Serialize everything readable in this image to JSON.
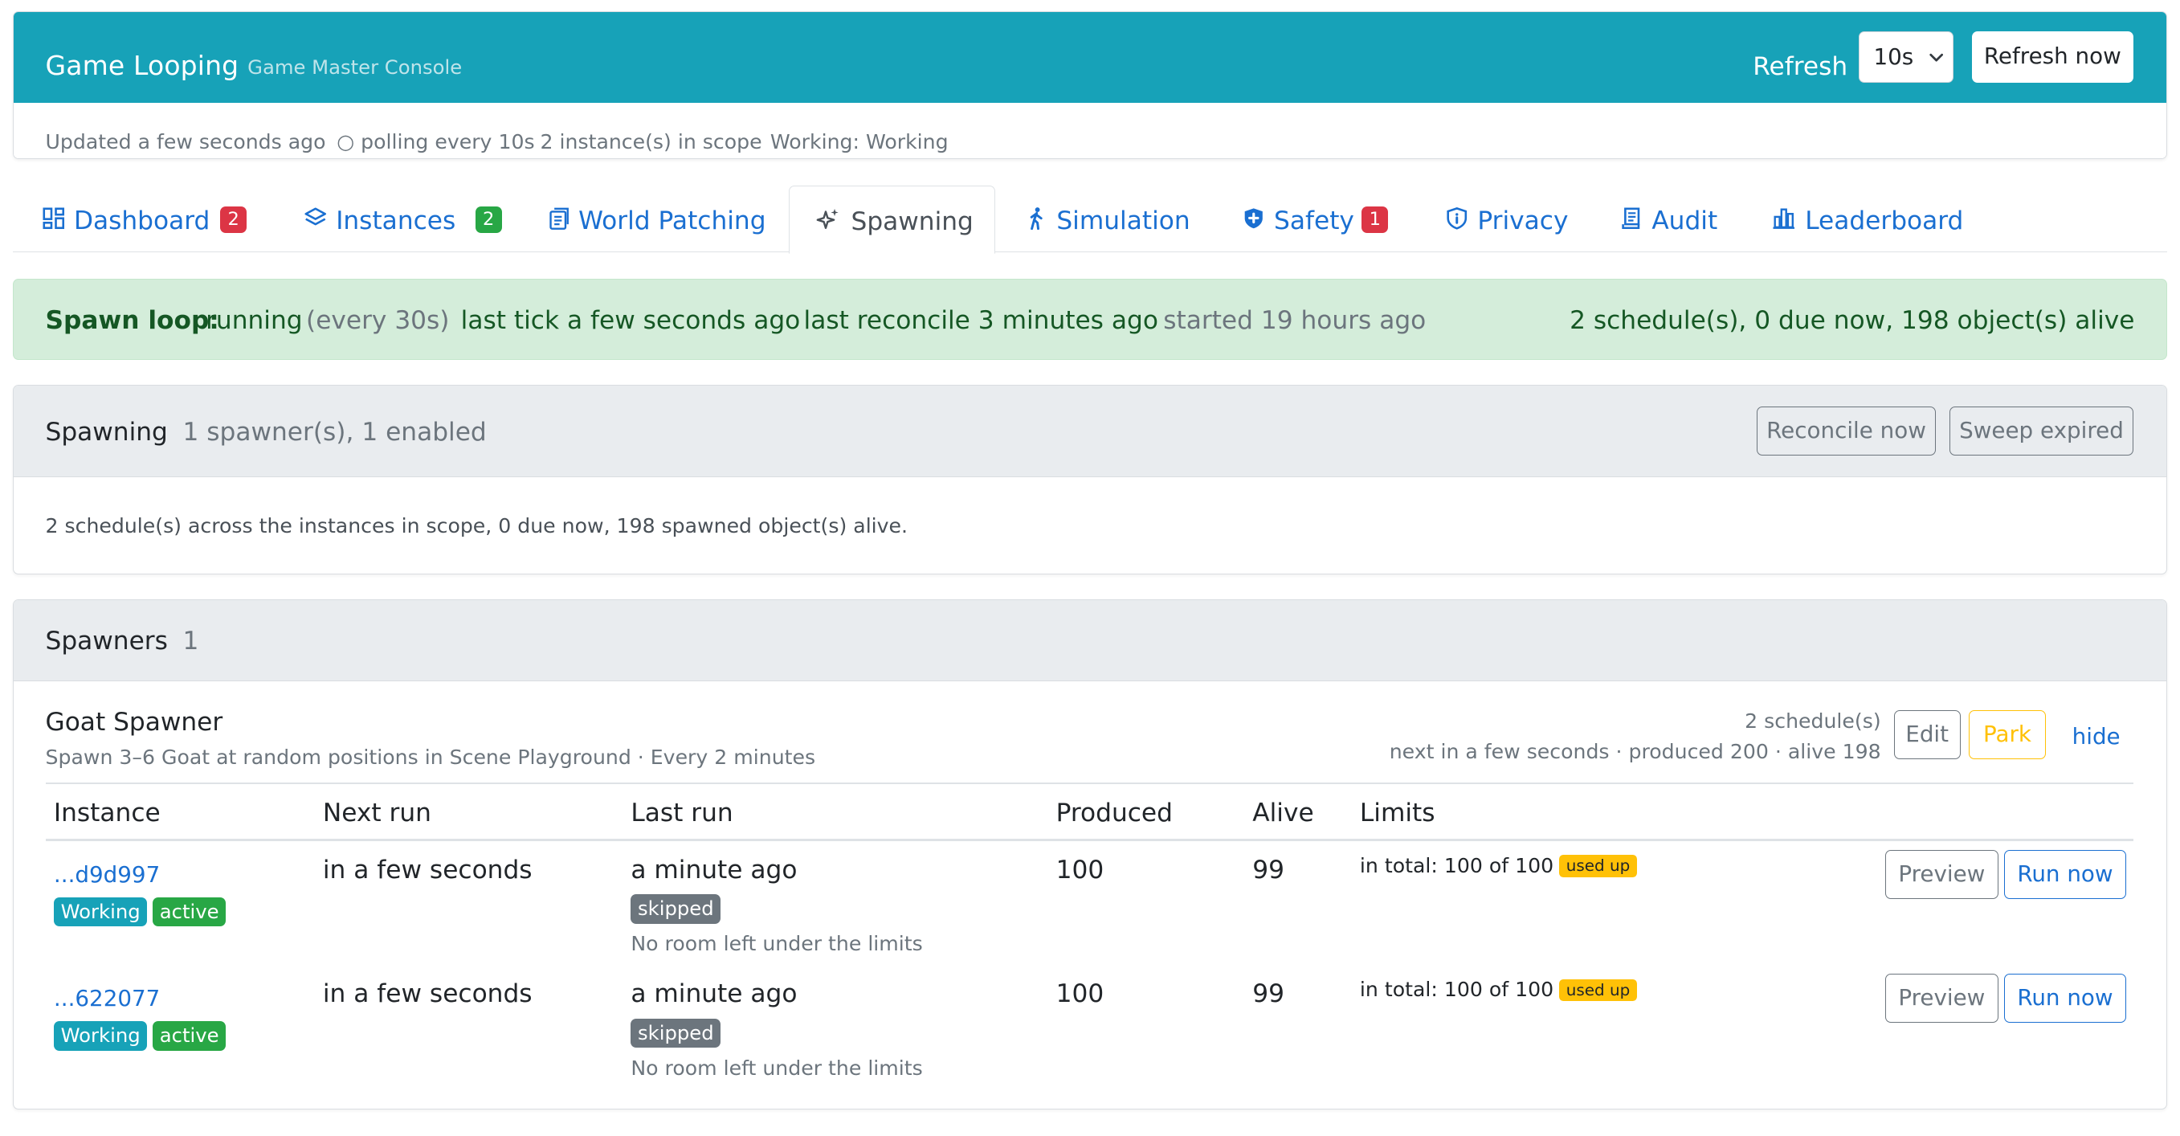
{
  "header": {
    "title": "Game Looping",
    "subtitle": "Game Master Console",
    "refresh_label": "Refresh",
    "refresh_interval": "10s",
    "refresh_now": "Refresh now"
  },
  "status": {
    "updated": "Updated a few seconds ago",
    "polling": "○ polling every 10s",
    "scope": "2 instance(s) in scope",
    "working": "Working: Working"
  },
  "tabs": [
    {
      "label": "Dashboard",
      "icon": "dashboard-icon",
      "count": "2",
      "count_color": "#dc3545"
    },
    {
      "label": "Instances",
      "icon": "layers-icon",
      "count": "2",
      "count_color": "#28a745"
    },
    {
      "label": "World Patching",
      "icon": "document-icon"
    },
    {
      "label": "Spawning",
      "icon": "sparkles-icon",
      "active": true
    },
    {
      "label": "Simulation",
      "icon": "walking-person-icon"
    },
    {
      "label": "Safety",
      "icon": "shield-plus-icon",
      "count": "1",
      "count_color": "#dc3545"
    },
    {
      "label": "Privacy",
      "icon": "shield-info-icon"
    },
    {
      "label": "Audit",
      "icon": "journal-icon"
    },
    {
      "label": "Leaderboard",
      "icon": "bar-chart-icon"
    }
  ],
  "spawn_loop": {
    "label": "Spawn loop:",
    "state": "running",
    "interval": "(every 30s)",
    "last_tick": "last tick a few seconds ago",
    "last_reconcile": "last reconcile 3 minutes ago",
    "started": "started 19 hours ago",
    "summary": "2 schedule(s), 0 due now, 198 object(s) alive"
  },
  "spawning_card": {
    "title": "Spawning",
    "subtitle": "1 spawner(s), 1 enabled",
    "reconcile_button": "Reconcile now",
    "sweep_button": "Sweep expired",
    "body": "2 schedule(s) across the instances in scope, 0 due now, 198 spawned object(s) alive."
  },
  "spawners_card": {
    "title": "Spawners",
    "count": "1"
  },
  "spawner": {
    "name": "Goat Spawner",
    "description": "Spawn 3–6 Goat at random positions in Scene Playground · Every 2 minutes",
    "schedules": "2 schedule(s)",
    "next_info": "next in a few seconds · produced 200 · alive 198",
    "edit_button": "Edit",
    "park_button": "Park",
    "hide_link": "hide",
    "columns": [
      "Instance",
      "Next run",
      "Last run",
      "Produced",
      "Alive",
      "Limits"
    ],
    "rows": [
      {
        "instance": "...d9d997",
        "badge_state": "Working",
        "badge_status": "active",
        "next_run": "in a few seconds",
        "last_run": "a minute ago",
        "last_result": "skipped",
        "last_note": "No room left under the limits",
        "produced": "100",
        "alive": "99",
        "limit": "in total: 100 of 100",
        "limit_badge": "used up",
        "preview_button": "Preview",
        "run_button": "Run now"
      },
      {
        "instance": "...622077",
        "badge_state": "Working",
        "badge_status": "active",
        "next_run": "in a few seconds",
        "last_run": "a minute ago",
        "last_result": "skipped",
        "last_note": "No room left under the limits",
        "produced": "100",
        "alive": "99",
        "limit": "in total: 100 of 100",
        "limit_badge": "used up",
        "preview_button": "Preview",
        "run_button": "Run now"
      }
    ]
  },
  "colors": {
    "header_bg": "#17a2b8",
    "link": "#1a6fd1",
    "success_bg": "#d4edda",
    "success_text": "#155724",
    "badge_info": "#17a2b8",
    "badge_success": "#28a745",
    "badge_secondary": "#6c757d",
    "warning": "#ffc107",
    "danger": "#dc3545"
  }
}
